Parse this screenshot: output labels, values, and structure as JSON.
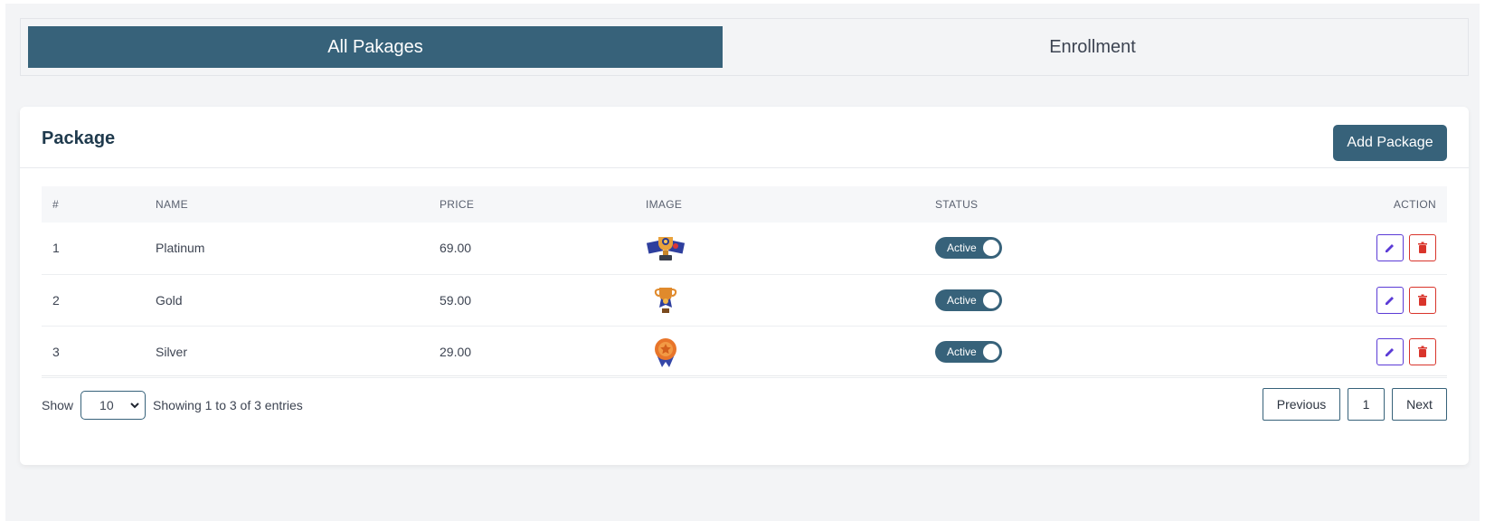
{
  "tabs": [
    {
      "label": "All Pakages",
      "active": true
    },
    {
      "label": "Enrollment",
      "active": false
    }
  ],
  "card": {
    "title": "Package",
    "add_button": "Add Package"
  },
  "table": {
    "headers": [
      "#",
      "NAME",
      "PRICE",
      "IMAGE",
      "STATUS",
      "ACTION"
    ],
    "rows": [
      {
        "num": "1",
        "name": "Platinum",
        "price": "69.00",
        "image": "trophy-banner-icon",
        "status": "Active"
      },
      {
        "num": "2",
        "name": "Gold",
        "price": "59.00",
        "image": "trophy-cup-icon",
        "status": "Active"
      },
      {
        "num": "3",
        "name": "Silver",
        "price": "29.00",
        "image": "medal-icon",
        "status": "Active"
      }
    ]
  },
  "footer": {
    "show_label": "Show",
    "page_size": "10",
    "entries_text": "Showing 1 to 3 of 3 entries",
    "previous": "Previous",
    "current_page": "1",
    "next": "Next"
  },
  "colors": {
    "primary": "#37627a",
    "edit": "#5b3bd6",
    "delete": "#d9342b"
  }
}
